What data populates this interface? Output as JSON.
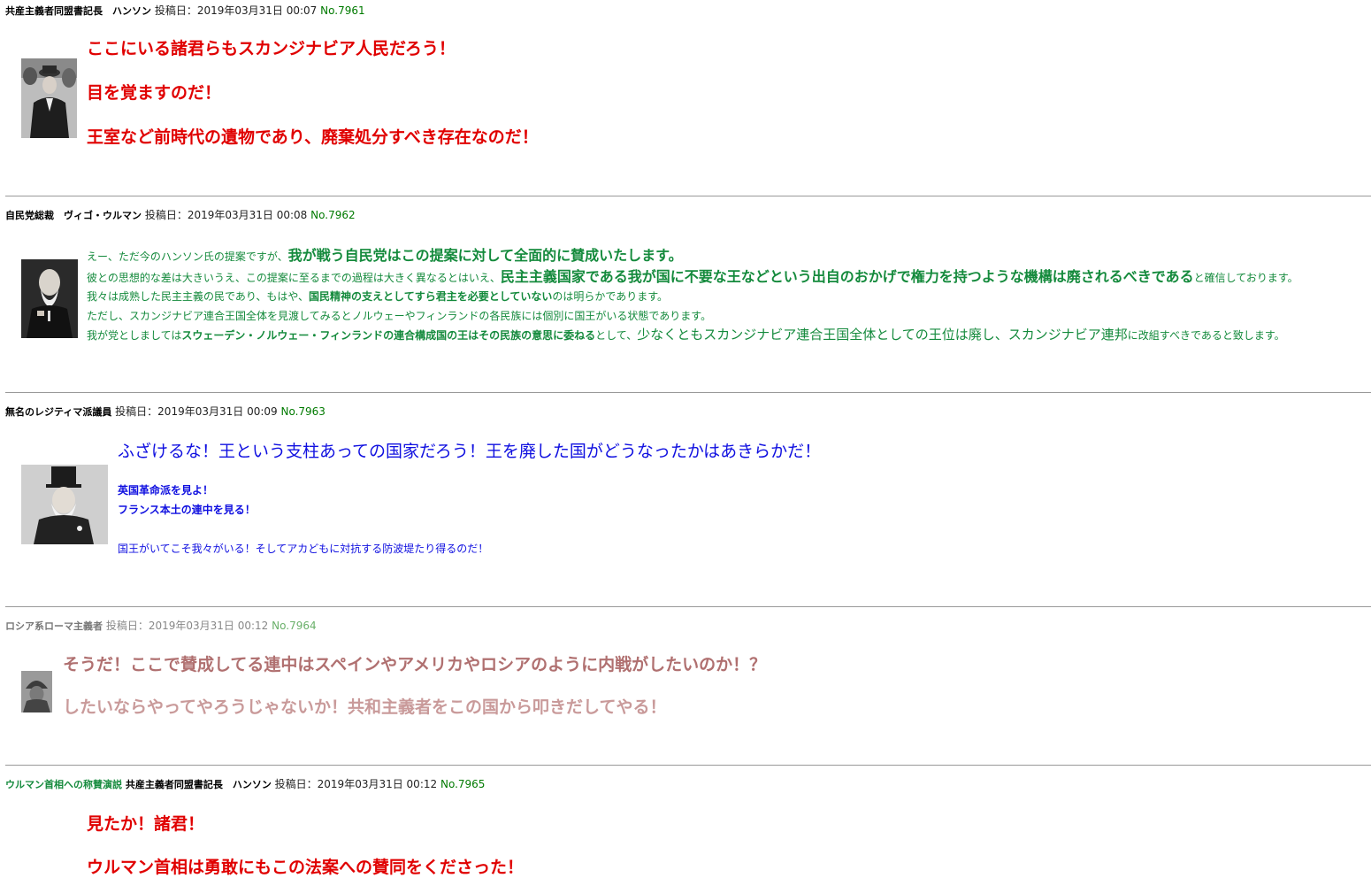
{
  "posts": [
    {
      "name": "共産主義者同盟書記長　ハンソン",
      "date": "投稿日：2019年03月31日 00:07",
      "number": "No.7961",
      "avatar": "man-in-hat-photo",
      "lines": [
        "ここにいる諸君らもスカンジナビア人民だろう！",
        "目を覚ますのだ！",
        "王室など前時代の遺物であり、廃棄処分すべき存在なのだ！"
      ]
    },
    {
      "name": "自民党総裁　ヴィゴ・ウルマン",
      "date": "投稿日：2019年03月31日 00:08",
      "number": "No.7962",
      "avatar": "bearded-man-photo",
      "lines": [
        {
          "a": "えー、ただ今のハンソン氏の提案ですが、",
          "b": "我が戦う自民党はこの提案に対して全面的に賛成いたします。"
        },
        {
          "a": "彼との思想的な差は大きいうえ、この提案に至るまでの過程は大きく異なるとはいえ、",
          "b": "民主主義国家である我が国に不要な王などという出自のおかげで権力を持つような機構は廃されるべきである",
          "c": "と確信しております。"
        },
        {
          "a": "我々は成熟した民主主義の民であり、もはや、",
          "b": "国民精神の支えとしてすら君主を必要としていない",
          "c": "のは明らかであります。"
        },
        {
          "a": "ただし、スカンジナビア連合王国全体を見渡してみるとノルウェーやフィンランドの各民族には個別に国王がいる状態であります。"
        },
        {
          "a": "我が党としましては",
          "b": "スウェーデン・ノルウェー・フィンランドの連合構成国の王はその民族の意思に委ねる",
          "c": "として、",
          "d": "少なくともスカンジナビア連合王国全体としての王位は廃し、スカンジナビア連邦",
          "e": "に改組すべきであると致します。"
        }
      ]
    },
    {
      "name": "無名のレジティマ派議員",
      "date": "投稿日：2019年03月31日 00:09",
      "number": "No.7963",
      "avatar": "top-hat-man-photo",
      "lines": [
        "ふざけるな！王という支柱あっての国家だろう！王を廃した国がどうなったかはあきらかだ！",
        "英国革命派を見よ！",
        "フランス本土の連中を見る！",
        "国王がいてこそ我々がいる！そしてアカどもに対抗する防波堤たり得るのだ！"
      ]
    },
    {
      "name": "ロシア系ローマ主義者",
      "date": "投稿日：2019年03月31日 00:12",
      "number": "No.7964",
      "avatar": "soldier-photo",
      "lines": [
        "そうだ！ここで賛成してる連中はスペインやアメリカやロシアのように内戦がしたいのか！？",
        "したいならやってやろうじゃないか！共和主義者をこの国から叩きだしてやる！"
      ]
    },
    {
      "name_prefix": "ウルマン首相への称賛演説",
      "name": "共産主義者同盟書記長　ハンソン",
      "date": "投稿日：2019年03月31日 00:12",
      "number": "No.7965",
      "lines": [
        "見たか！諸君！",
        "ウルマン首相は勇敢にもこの法案への賛同をくださった！"
      ]
    }
  ],
  "colors": {
    "red": "#e00000",
    "green": "#148a3c",
    "blue": "#1010e0",
    "rose": "#b07070",
    "post_number": "#007a00"
  }
}
